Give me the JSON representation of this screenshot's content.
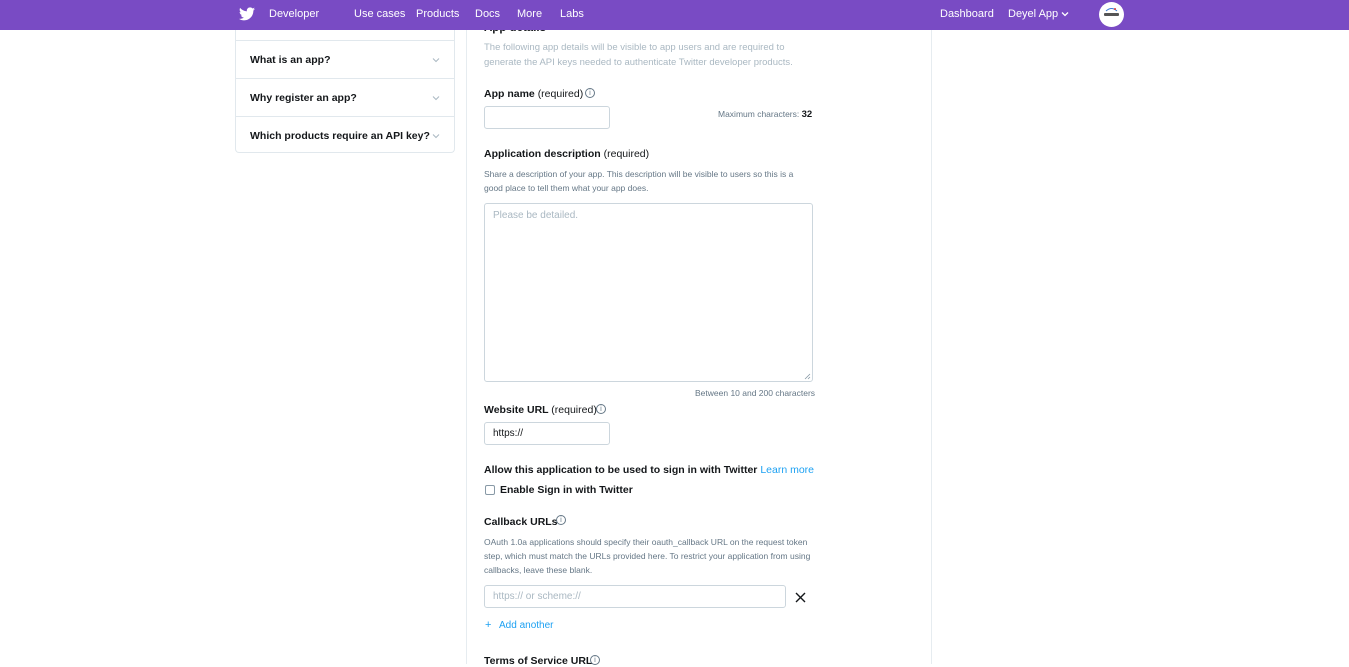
{
  "nav": {
    "brand": "Developer",
    "links": [
      "Use cases",
      "Products",
      "Docs",
      "More",
      "Labs"
    ],
    "dashboard": "Dashboard",
    "app_menu": "Deyel App"
  },
  "sidebar": {
    "faq_items": [
      {
        "label": "What is an app?"
      },
      {
        "label": "Why register an app?"
      },
      {
        "label": "Which products require an API key?"
      }
    ]
  },
  "form": {
    "section_title": "App details",
    "section_desc_1": "The following app details will be visible to app users and are required to",
    "section_desc_2": "generate the API keys needed to authenticate Twitter developer products.",
    "app_name": {
      "label": "App name",
      "required": "(required)",
      "max_label": "Maximum characters:",
      "max_value": "32",
      "value": ""
    },
    "description": {
      "label": "Application description",
      "required": "(required)",
      "help_1": "Share a description of your app. This description will be visible to users so this is a",
      "help_2": "good place to tell them what your app does.",
      "placeholder": "Please be detailed.",
      "counter": "Between 10 and 200 characters"
    },
    "website": {
      "label": "Website URL",
      "required": "(required)",
      "value": "https://"
    },
    "signin": {
      "label": "Allow this application to be used to sign in with Twitter",
      "learn_more": "Learn more",
      "checkbox_label": "Enable Sign in with Twitter",
      "checked": false
    },
    "callback": {
      "label": "Callback URLs",
      "help_1": "OAuth 1.0a applications should specify their oauth_callback URL on the request token",
      "help_2": "step, which must match the URLs provided here. To restrict your application from using",
      "help_3": "callbacks, leave these blank.",
      "placeholder": "https:// or scheme://",
      "add_another": "Add another"
    },
    "terms": {
      "label": "Terms of Service URL"
    }
  },
  "colors": {
    "nav_bg": "#794bc4",
    "link": "#1da1f2",
    "border": "#ccd6dd"
  }
}
